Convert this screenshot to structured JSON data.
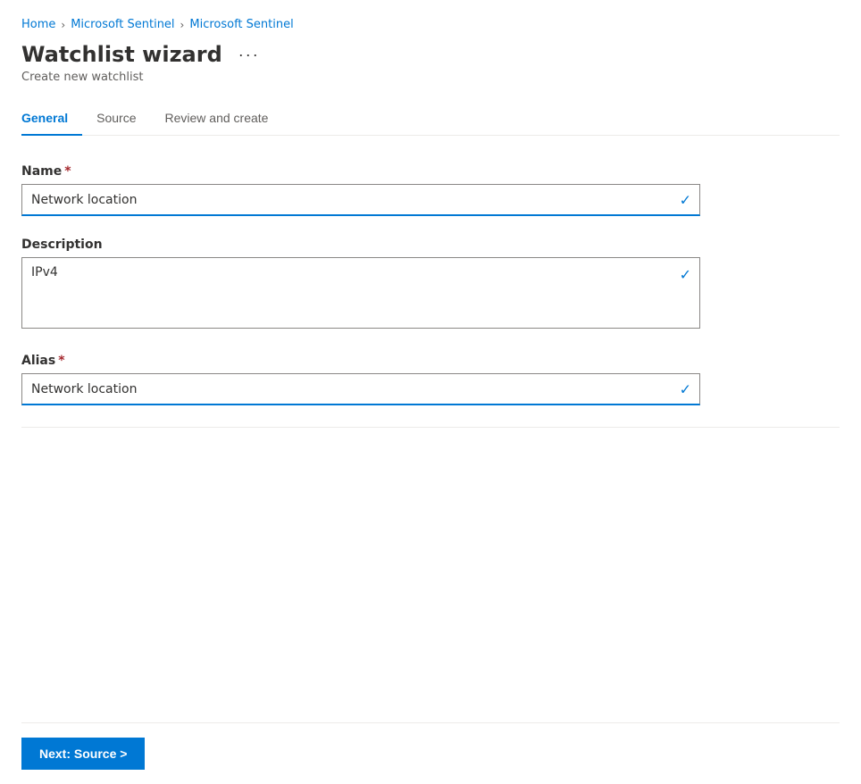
{
  "breadcrumb": {
    "items": [
      {
        "label": "Home",
        "href": "#"
      },
      {
        "label": "Microsoft Sentinel",
        "href": "#"
      },
      {
        "label": "Microsoft Sentinel",
        "href": "#"
      }
    ]
  },
  "page": {
    "title": "Watchlist wizard",
    "subtitle": "Create new watchlist",
    "more_options_label": "···"
  },
  "tabs": [
    {
      "id": "general",
      "label": "General",
      "active": true
    },
    {
      "id": "source",
      "label": "Source",
      "active": false
    },
    {
      "id": "review",
      "label": "Review and create",
      "active": false
    }
  ],
  "form": {
    "name_label": "Name",
    "name_value": "Network location",
    "description_label": "Description",
    "description_value": "IPv4",
    "alias_label": "Alias",
    "alias_value": "Network location"
  },
  "footer": {
    "next_button_label": "Next: Source >"
  }
}
